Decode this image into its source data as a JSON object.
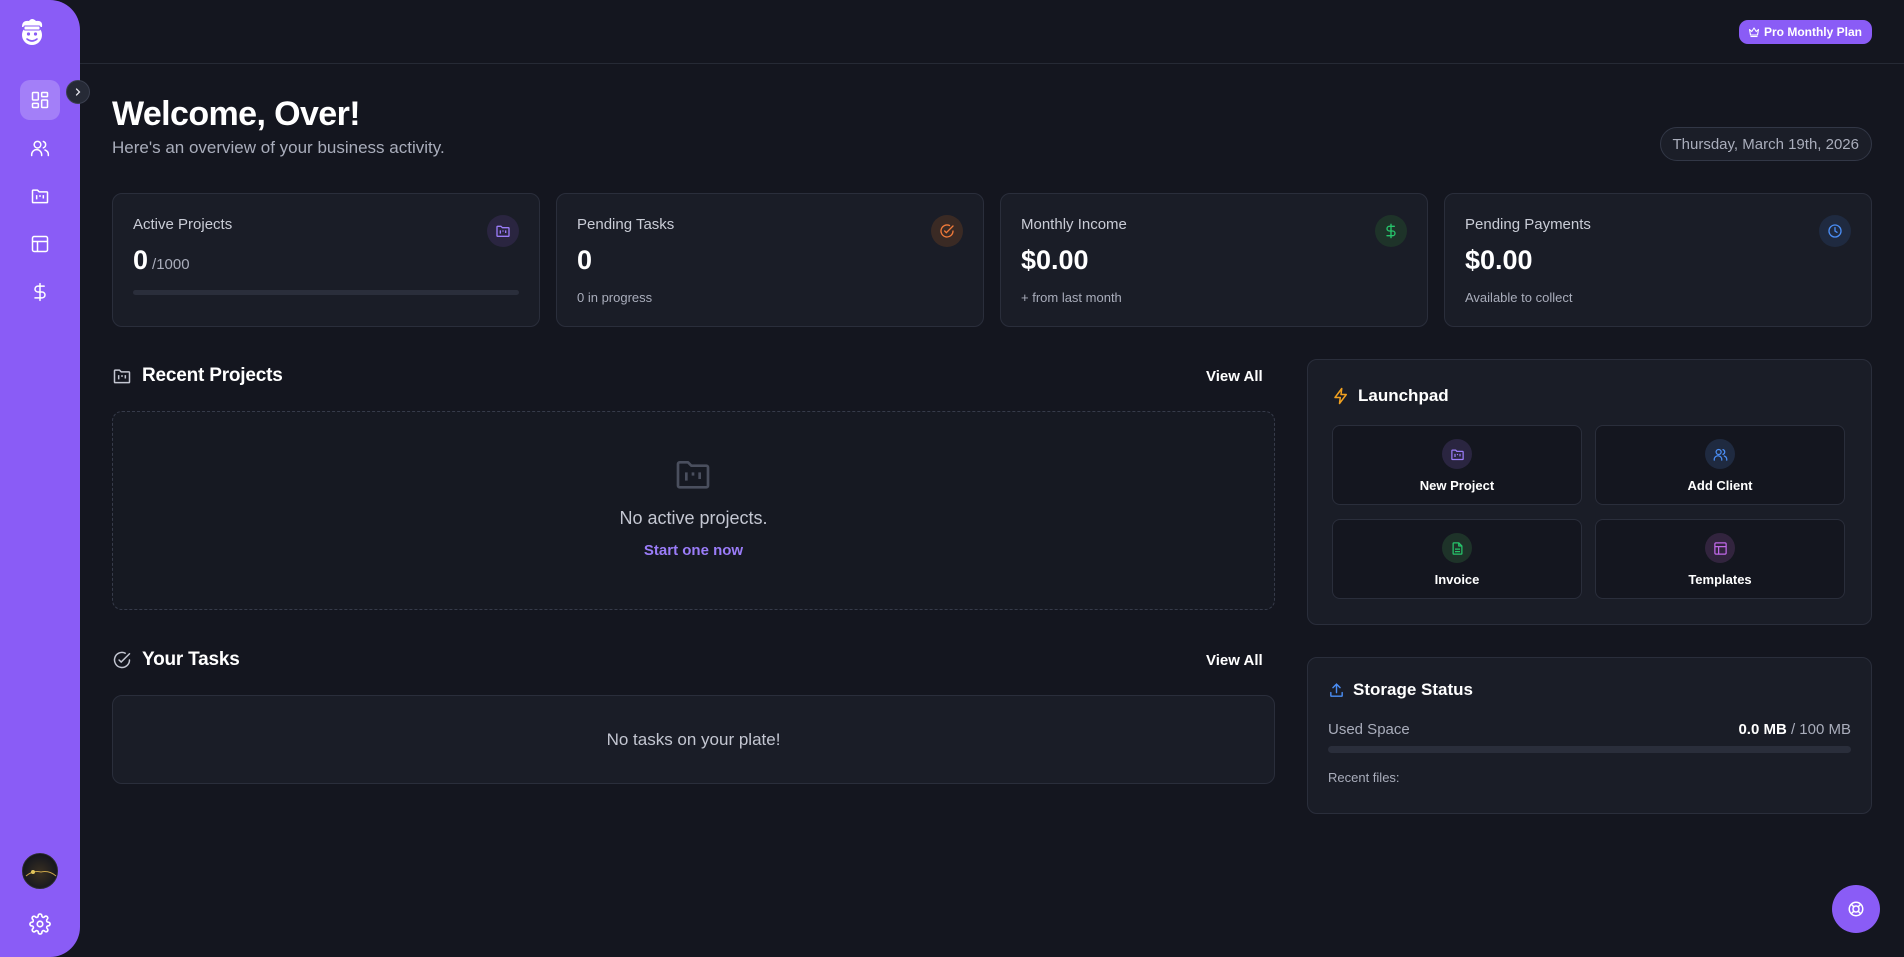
{
  "sidebar": {
    "logo_icon": "chef-mascot-logo-icon",
    "items": [
      {
        "icon": "dashboard-icon",
        "active": true
      },
      {
        "icon": "users-icon",
        "active": false
      },
      {
        "icon": "projects-folder-icon",
        "active": false
      },
      {
        "icon": "templates-icon",
        "active": false
      },
      {
        "icon": "dollar-icon",
        "active": false
      }
    ],
    "accent_color": "#8a5cf6"
  },
  "topbar": {
    "plan_badge": "Pro Monthly Plan"
  },
  "welcome": {
    "title": "Welcome, Over!",
    "subtitle": "Here's an overview of your business activity.",
    "date": "Thursday, March 19th, 2026"
  },
  "stats": [
    {
      "label": "Active Projects",
      "value": "0",
      "suffix": "/1000",
      "progress": 0
    },
    {
      "label": "Pending Tasks",
      "value": "0",
      "sub": "0 in progress"
    },
    {
      "label": "Monthly Income",
      "value": "$0.00",
      "sub": "+ from last month"
    },
    {
      "label": "Pending Payments",
      "value": "$0.00",
      "sub": "Available to collect"
    }
  ],
  "recent_projects": {
    "title": "Recent Projects",
    "view_all": "View All",
    "empty_message": "No active projects.",
    "start_link": "Start one now"
  },
  "tasks": {
    "title": "Your Tasks",
    "view_all": "View All",
    "empty_message": "No tasks on your plate!"
  },
  "launchpad": {
    "title": "Launchpad",
    "tiles": [
      {
        "label": "New Project",
        "icon": "folder-icon"
      },
      {
        "label": "Add Client",
        "icon": "users-icon"
      },
      {
        "label": "Invoice",
        "icon": "document-icon"
      },
      {
        "label": "Templates",
        "icon": "layout-icon"
      }
    ]
  },
  "storage": {
    "title": "Storage Status",
    "used_label": "Used Space",
    "used_value": "0.0 MB",
    "total_value": "/ 100 MB",
    "used_fraction": 0,
    "recent_files_label": "Recent files:"
  }
}
